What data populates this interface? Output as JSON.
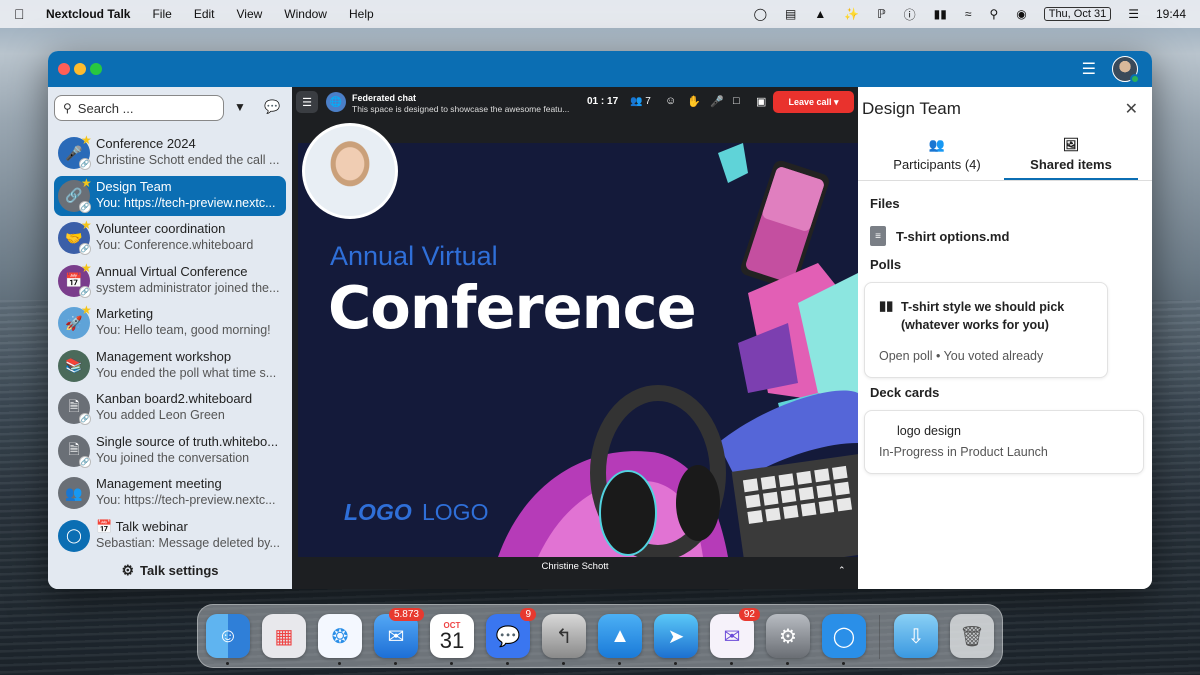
{
  "menubar": {
    "app_name": "Nextcloud Talk",
    "items": [
      "File",
      "Edit",
      "View",
      "Window",
      "Help"
    ],
    "date": "Thu, Oct 31",
    "time": "19:44"
  },
  "sidebar": {
    "search_placeholder": "Search ...",
    "conversations": [
      {
        "name": "Conference 2024",
        "message": "Christine Schott ended the call ...",
        "icon": "microphone-icon",
        "color": "#2a6ab8"
      },
      {
        "name": "Design Team",
        "message": "You: https://tech-preview.nextc...",
        "icon": "link-icon",
        "color": "#6a6f76",
        "active": true
      },
      {
        "name": "Volunteer coordination",
        "message": "You: Conference.whiteboard",
        "icon": "handshake-icon",
        "color": "#3b5fa8"
      },
      {
        "name": "Annual Virtual Conference",
        "message": "system administrator joined the...",
        "icon": "calendar-icon",
        "color": "#7a3d8c"
      },
      {
        "name": "Marketing",
        "message": "You: Hello team, good morning!",
        "icon": "rocket-icon",
        "color": "#5fa3d8"
      },
      {
        "name": "Management workshop",
        "message": "You ended the poll what time s...",
        "icon": "books-icon",
        "color": "#4a6a5a"
      },
      {
        "name": "Kanban board2.whiteboard",
        "message": "You added Leon Green",
        "icon": "document-icon",
        "color": "#6a6f76"
      },
      {
        "name": "Single source of truth.whitebo...",
        "message": "You joined the conversation",
        "icon": "document-icon",
        "color": "#6a6f76"
      },
      {
        "name": "Management meeting",
        "message": "You: https://tech-preview.nextc...",
        "icon": "group-icon",
        "color": "#6a6f76"
      },
      {
        "name": "📅 Talk webinar",
        "message": "Sebastian: Message deleted by...",
        "icon": "talk-logo-icon",
        "color": "#0b6eb3"
      }
    ],
    "settings_label": "Talk settings"
  },
  "call": {
    "title": "Federated chat",
    "subtitle": "This space is designed to showcase the awesome featu...",
    "duration": "01 : 17",
    "participants": "7",
    "leave_label": "Leave call",
    "slide_subtitle": "Annual Virtual",
    "slide_title": "Conference",
    "logo_a": "LOGO",
    "logo_b": "LOGO",
    "speaker": "Christine Schott"
  },
  "panel": {
    "title": "Design Team",
    "tabs": [
      {
        "label": "Participants (4)"
      },
      {
        "label": "Shared items"
      }
    ],
    "files_heading": "Files",
    "file_name": "T-shirt options.md",
    "polls_heading": "Polls",
    "poll_question": "T-shirt style we should pick (whatever works for you)",
    "poll_status": "Open poll • You voted already",
    "deck_heading": "Deck cards",
    "deck_title": "logo design",
    "deck_status": "In-Progress in Product Launch"
  },
  "dock": {
    "mail_badge": "5.873",
    "calendar_month": "OCT",
    "calendar_day": "31",
    "signal_badge": "9",
    "spark_badge": "92"
  },
  "colors": {
    "accent": "#0b6eb3",
    "leave": "#e9322d"
  }
}
